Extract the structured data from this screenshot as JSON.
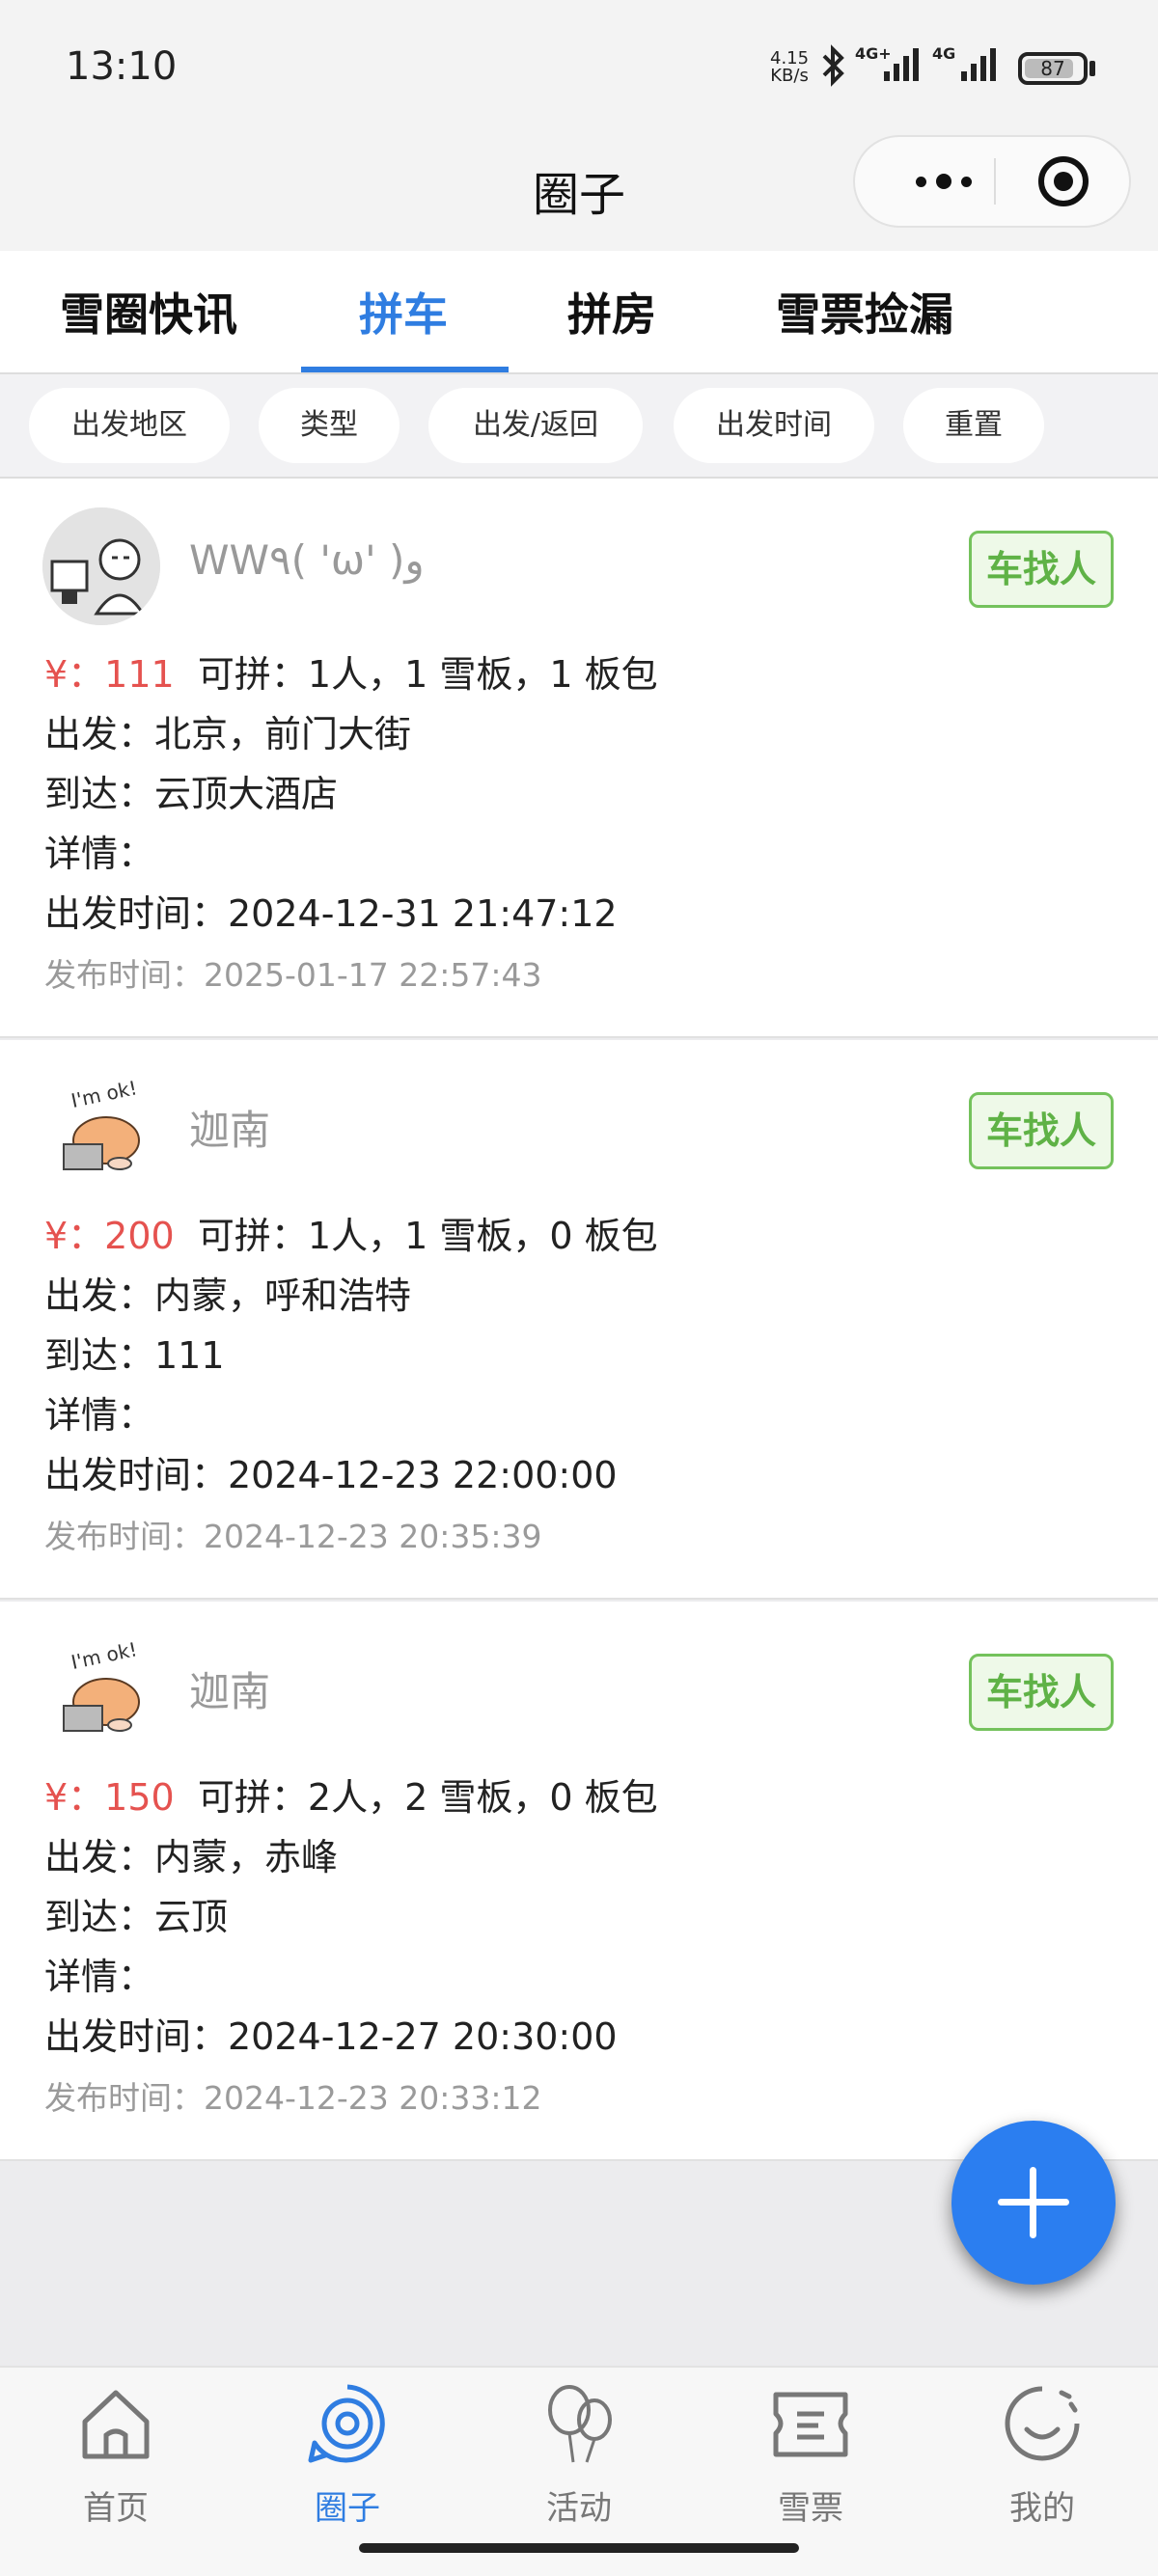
{
  "status": {
    "time": "13:10",
    "speed_top": "4.15",
    "speed_bottom": "KB/s",
    "network1": "4G+",
    "network2": "4G",
    "battery": "87",
    "battery_level": 0.87
  },
  "nav": {
    "title": "圈子"
  },
  "tabs": [
    "雪圈快讯",
    "拼车",
    "拼房",
    "雪票捡漏"
  ],
  "active_tab": 1,
  "filters": [
    "出发地区",
    "类型",
    "出发/返回",
    "出发时间",
    "重置"
  ],
  "cards": [
    {
      "user": "WW٩( 'ω' )و",
      "avatar_icon": "computer-user-avatar",
      "badge": "车找人",
      "price": "¥：111",
      "capacity": "可拼：1人，1 雪板，1 板包",
      "depart": "出发：北京，前门大街",
      "arrive": "到达：云顶大酒店",
      "details": "详情：",
      "depart_time": "出发时间：2024-12-31 21:47:12",
      "post_time": "发布时间：2025-01-17 22:57:43"
    },
    {
      "user": "迦南",
      "avatar_icon": "im-ok-sticker-avatar",
      "badge": "车找人",
      "price": "¥：200",
      "capacity": "可拼：1人，1 雪板，0 板包",
      "depart": "出发：内蒙，呼和浩特",
      "arrive": "到达：111",
      "details": "详情：",
      "depart_time": "出发时间：2024-12-23 22:00:00",
      "post_time": "发布时间：2024-12-23 20:35:39"
    },
    {
      "user": "迦南",
      "avatar_icon": "im-ok-sticker-avatar",
      "badge": "车找人",
      "price": "¥：150",
      "capacity": "可拼：2人，2 雪板，0 板包",
      "depart": "出发：内蒙，赤峰",
      "arrive": "到达：云顶",
      "details": "详情：",
      "depart_time": "出发时间：2024-12-27 20:30:00",
      "post_time": "发布时间：2024-12-23 20:33:12"
    }
  ],
  "tabbar": [
    {
      "label": "首页",
      "icon": "home-icon"
    },
    {
      "label": "圈子",
      "icon": "circle-target-icon"
    },
    {
      "label": "活动",
      "icon": "balloon-icon"
    },
    {
      "label": "雪票",
      "icon": "ticket-icon"
    },
    {
      "label": "我的",
      "icon": "smile-icon"
    }
  ],
  "tabbar_active": 1,
  "colors": {
    "accent": "#2f7de1",
    "price": "#e5524f",
    "badge": "#5fb246",
    "fab": "#2b7ef0"
  }
}
